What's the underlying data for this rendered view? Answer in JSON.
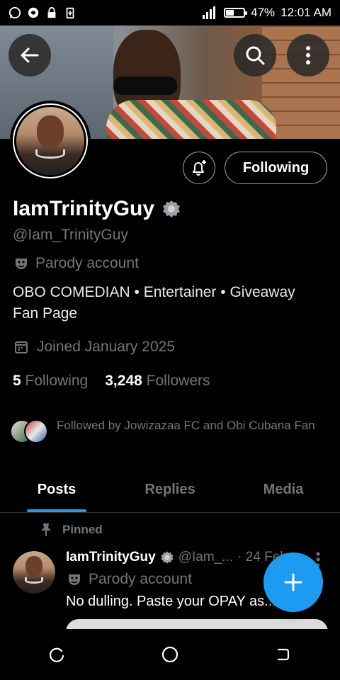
{
  "status_bar": {
    "battery": "47%",
    "time": "12:01 AM",
    "battery_level": 0.47
  },
  "profile": {
    "display_name": "IamTrinityGuy",
    "handle": "@Iam_TrinityGuy",
    "parody_label": "Parody account",
    "bio": "OBO COMEDIAN • Entertainer • Giveaway Fan Page",
    "joined": "Joined January 2025",
    "following_count": "5",
    "following_label": "Following",
    "followers_count": "3,248",
    "followers_label": "Followers",
    "followed_by": "Followed by Jowizazaa FC and Obi Cubana Fan"
  },
  "actions": {
    "following_button": "Following"
  },
  "tabs": [
    {
      "label": "Posts",
      "active": true
    },
    {
      "label": "Replies",
      "active": false
    },
    {
      "label": "Media",
      "active": false
    }
  ],
  "post": {
    "pinned_label": "Pinned",
    "name": "IamTrinityGuy",
    "handle": "@Iam_...",
    "date": "· 24 Feb",
    "parody_label": "Parody account",
    "text": "No dulling. Paste your OPAY as..."
  },
  "colors": {
    "accent": "#1d9bf0",
    "background": "#000000",
    "muted_text": "#71767b"
  },
  "icons": [
    "back-arrow-icon",
    "search-icon",
    "more-vertical-icon",
    "bell-plus-icon",
    "verified-badge-icon",
    "parody-mask-icon",
    "calendar-icon",
    "pin-icon",
    "plus-icon"
  ]
}
